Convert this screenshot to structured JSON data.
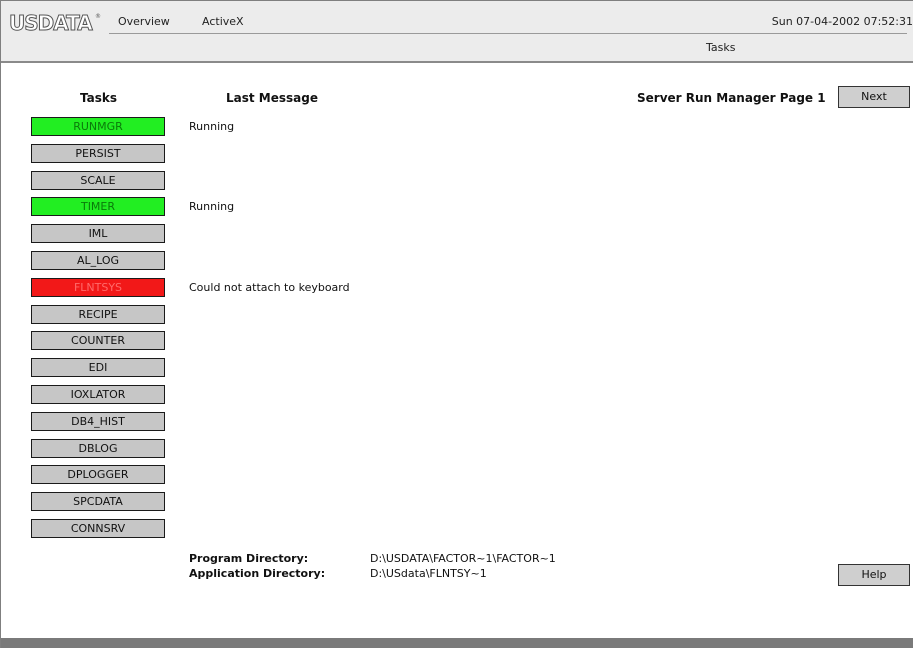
{
  "header": {
    "logo": "USDATA",
    "nav": [
      "Overview",
      "ActiveX"
    ],
    "datetime": "Sun 07-04-2002 07:52:31",
    "active_tab": "Tasks"
  },
  "columns": {
    "tasks": "Tasks",
    "last_message": "Last Message"
  },
  "page_title": "Server Run Manager Page 1",
  "next_label": "Next",
  "help_label": "Help",
  "tasks": [
    {
      "name": "RUNMGR",
      "status": "green",
      "message": "Running"
    },
    {
      "name": "PERSIST",
      "status": "gray",
      "message": ""
    },
    {
      "name": "SCALE",
      "status": "gray",
      "message": ""
    },
    {
      "name": "TIMER",
      "status": "green",
      "message": "Running"
    },
    {
      "name": "IML",
      "status": "gray",
      "message": ""
    },
    {
      "name": "AL_LOG",
      "status": "gray",
      "message": ""
    },
    {
      "name": "FLNTSYS",
      "status": "red",
      "message": "Could not attach to keyboard"
    },
    {
      "name": "RECIPE",
      "status": "gray",
      "message": ""
    },
    {
      "name": "COUNTER",
      "status": "gray",
      "message": ""
    },
    {
      "name": "EDI",
      "status": "gray",
      "message": ""
    },
    {
      "name": "IOXLATOR",
      "status": "gray",
      "message": ""
    },
    {
      "name": "DB4_HIST",
      "status": "gray",
      "message": ""
    },
    {
      "name": "DBLOG",
      "status": "gray",
      "message": ""
    },
    {
      "name": "DPLOGGER",
      "status": "gray",
      "message": ""
    },
    {
      "name": "SPCDATA",
      "status": "gray",
      "message": ""
    },
    {
      "name": "CONNSRV",
      "status": "gray",
      "message": ""
    }
  ],
  "directories": {
    "program_label": "Program Directory:",
    "program_value": "D:\\USDATA\\FACTOR~1\\FACTOR~1",
    "application_label": "Application Directory:",
    "application_value": "D:\\USdata\\FLNTSY~1"
  },
  "colors": {
    "running": "#22ee22",
    "error": "#f21818",
    "idle": "#c6c6c6"
  }
}
